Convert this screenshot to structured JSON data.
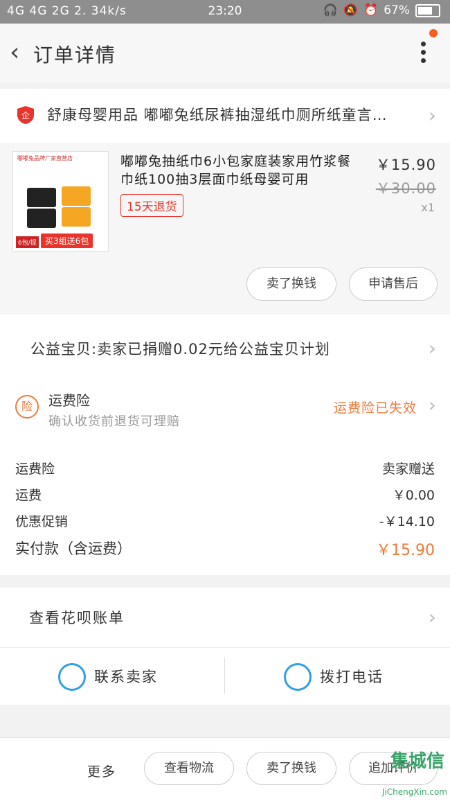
{
  "status_bar": {
    "network": "4G 4G 2G 2. 34k/s",
    "time": "23:20",
    "battery": "67%"
  },
  "header": {
    "back_icon": "‹",
    "title": "订单详情"
  },
  "shop": {
    "name": "舒康母婴用品 嘟嘟兔纸尿裤抽湿纸巾厕所纸童言…"
  },
  "product": {
    "thumb_header": "嘟嘟兔品牌厂家直营店",
    "thumb_promo": "买3组送6包",
    "thumb_badge": "6包/提",
    "title": "嘟嘟兔抽纸巾6小包家庭装家用竹浆餐巾纸100抽3层面巾纸母婴可用",
    "price": "￥15.90",
    "original_price": "￥30.00",
    "quantity": "x1",
    "return_tag": "15天退货",
    "buttons": [
      "卖了换钱",
      "申请售后"
    ]
  },
  "charity": {
    "text": "公益宝贝:卖家已捐赠0.02元给公益宝贝计划"
  },
  "insurance": {
    "icon": "险",
    "title": "运费险",
    "subtitle": "确认收货前退货可理赔",
    "status": "运费险已失效"
  },
  "fees": {
    "rows": [
      {
        "label": "运费险",
        "value": "卖家赠送"
      },
      {
        "label": "运费",
        "value": "￥0.00"
      },
      {
        "label": "优惠促销",
        "value": "-￥14.10"
      }
    ],
    "total_label": "实付款（含运费）",
    "total_value": "￥15.90"
  },
  "huabei": {
    "text": "查看花呗账单"
  },
  "contact": {
    "seller": "联系卖家",
    "call": "拨打电话"
  },
  "bottom_bar": {
    "more": "更多",
    "buttons": [
      "查看物流",
      "卖了换钱",
      "追加评价"
    ]
  },
  "watermark": {
    "logo": "集城信",
    "url": "JiChengXin.com"
  },
  "colors": {
    "accent": "#f07a3a",
    "red": "#e8342a",
    "blue": "#2ea0e6"
  }
}
